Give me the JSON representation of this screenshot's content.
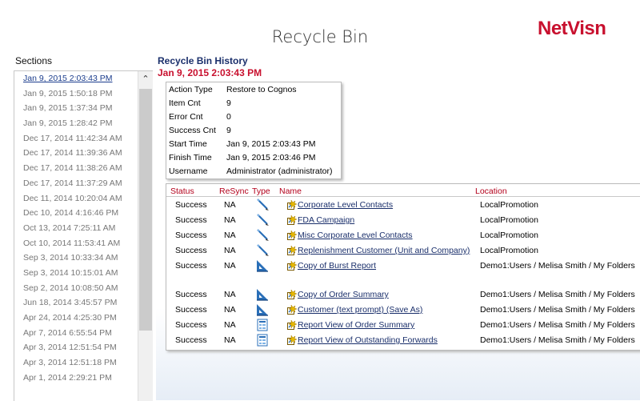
{
  "page": {
    "title": "Recycle Bin"
  },
  "logo": {
    "part1": "Net",
    "part2": "Visn"
  },
  "sidebar": {
    "label": "Sections",
    "items": [
      "Jan 9, 2015 2:03:43 PM",
      "Jan 9, 2015 1:50:18 PM",
      "Jan 9, 2015 1:37:34 PM",
      "Jan 9, 2015 1:28:42 PM",
      "Dec 17, 2014 11:42:34 AM",
      "Dec 17, 2014 11:39:36 AM",
      "Dec 17, 2014 11:38:26 AM",
      "Dec 17, 2014 11:37:29 AM",
      "Dec 11, 2014 10:20:04 AM",
      "Dec 10, 2014 4:16:46 PM",
      "Oct 13, 2014 7:25:11 AM",
      "Oct 10, 2014 11:53:41 AM",
      "Sep 3, 2014 10:33:34 AM",
      "Sep 3, 2014 10:15:01 AM",
      "Sep 2, 2014 10:08:50 AM",
      "Jun 18, 2014 3:45:57 PM",
      "Apr 24, 2014 4:25:30 PM",
      "Apr 7, 2014 6:55:54 PM",
      "Apr 3, 2014 12:51:54 PM",
      "Apr 3, 2014 12:51:18 PM",
      "Apr 1, 2014 2:29:21 PM"
    ]
  },
  "history": {
    "title": "Recycle Bin History",
    "date": "Jan 9, 2015 2:03:43 PM",
    "info": [
      {
        "key": "Action Type",
        "value": "Restore to Cognos"
      },
      {
        "key": "Item Cnt",
        "value": "9"
      },
      {
        "key": "Error Cnt",
        "value": "0"
      },
      {
        "key": "Success Cnt",
        "value": "9"
      },
      {
        "key": "Start Time",
        "value": "Jan 9, 2015 2:03:43 PM"
      },
      {
        "key": "Finish Time",
        "value": "Jan 9, 2015 2:03:46 PM"
      },
      {
        "key": "Username",
        "value": "Administrator (administrator)"
      }
    ]
  },
  "results": {
    "headers": {
      "status": "Status",
      "resync": "ReSync",
      "type": "Type",
      "name": "Name",
      "location": "Location"
    },
    "rows": [
      {
        "status": "Success",
        "resync": "NA",
        "type": "pencil-icon",
        "name": "Corporate Level Contacts",
        "location": "LocalPromotion"
      },
      {
        "status": "Success",
        "resync": "NA",
        "type": "pencil-icon",
        "name": "FDA Campaign",
        "location": "LocalPromotion"
      },
      {
        "status": "Success",
        "resync": "NA",
        "type": "pencil-icon",
        "name": "Misc Corporate Level Contacts",
        "location": "LocalPromotion"
      },
      {
        "status": "Success",
        "resync": "NA",
        "type": "pencil-icon",
        "name": "Replenishment Customer (Unit and Company)",
        "location": "LocalPromotion"
      },
      {
        "status": "Success",
        "resync": "NA",
        "type": "triangle-ruler-icon",
        "name": "Copy of Burst Report",
        "location": "Demo1:Users / Melisa Smith / My Folders"
      },
      {
        "status": "Success",
        "resync": "NA",
        "type": "triangle-ruler-icon",
        "name": "Copy of Order Summary",
        "location": "Demo1:Users / Melisa Smith / My Folders"
      },
      {
        "status": "Success",
        "resync": "NA",
        "type": "triangle-ruler-icon",
        "name": "Customer (text prompt) (Save As)",
        "location": "Demo1:Users / Melisa Smith / My Folders"
      },
      {
        "status": "Success",
        "resync": "NA",
        "type": "report-view-icon",
        "name": "Report View of Order Summary",
        "location": "Demo1:Users / Melisa Smith / My Folders"
      },
      {
        "status": "Success",
        "resync": "NA",
        "type": "report-view-icon",
        "name": "Report View of Outstanding Forwards",
        "location": "Demo1:Users / Melisa Smith / My Folders"
      }
    ]
  },
  "colors": {
    "accent_red": "#c8102e",
    "header_red": "#b3001b",
    "link_blue": "#1a2f6b"
  }
}
